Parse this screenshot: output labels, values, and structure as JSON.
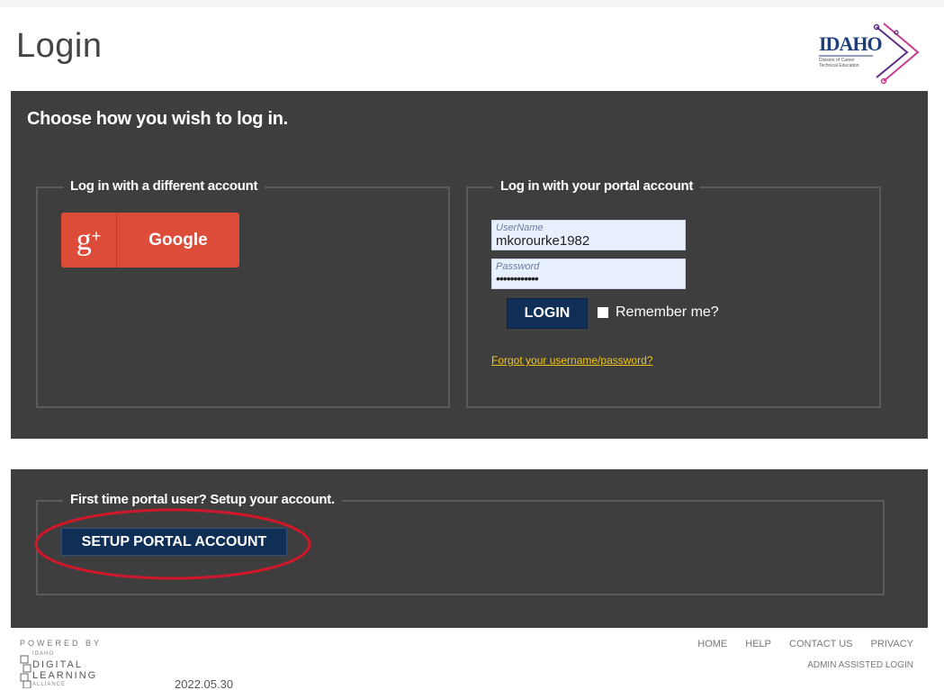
{
  "page": {
    "title": "Login"
  },
  "brand": {
    "logo_word": "IDAHO",
    "logo_sub_1": "Division of Career",
    "logo_sub_2": "Technical Education"
  },
  "login_panel": {
    "heading": "Choose how you wish to log in.",
    "external": {
      "legend": "Log in with a different account",
      "google_icon_glyph": "g",
      "google_icon_plus": "+",
      "google_label": "Google"
    },
    "portal": {
      "legend": "Log in with your portal account",
      "username_placeholder": "UserName",
      "username_value": "mkorourke1982",
      "password_placeholder": "Password",
      "password_mask": "••••••••••••",
      "login_label": "LOGIN",
      "remember_label": "Remember me?",
      "forgot_link": "Forgot your username/password?"
    }
  },
  "setup_panel": {
    "legend": "First time portal user? Setup your account.",
    "button_label": "SETUP PORTAL ACCOUNT"
  },
  "footer": {
    "powered_by": "POWERED BY",
    "dla_idaho": "IDAHO",
    "dla_line1": "DIGITAL",
    "dla_line2": "LEARNING",
    "dla_line3": "ALLIANCE",
    "version": "2022.05.30",
    "links": [
      "HOME",
      "HELP",
      "CONTACT US",
      "PRIVACY"
    ],
    "admin_login": "ADMIN ASSISTED LOGIN"
  },
  "colors": {
    "panel_bg": "#3e3e3e",
    "google_red": "#dd4b39",
    "navy_button": "#0f2f57",
    "link_yellow": "#f0c419",
    "annotation_red": "#d0182a"
  },
  "icons": [
    "google-plus-icon",
    "idaho-logo-icon",
    "dla-logo-icon"
  ]
}
